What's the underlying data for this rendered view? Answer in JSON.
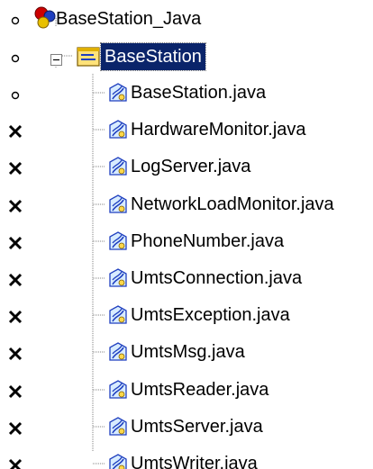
{
  "tree": {
    "root": {
      "label": "BaseStation_Java",
      "icon": "project-icon",
      "status": "circle"
    },
    "package": {
      "label": "BaseStation",
      "icon": "package-icon",
      "status": "circle",
      "selected": true,
      "expander": "minus"
    },
    "files": [
      {
        "label": "BaseStation.java",
        "status": "circle",
        "icon": "java-file-icon"
      },
      {
        "label": "HardwareMonitor.java",
        "status": "cross",
        "icon": "java-file-icon"
      },
      {
        "label": "LogServer.java",
        "status": "cross",
        "icon": "java-file-icon"
      },
      {
        "label": "NetworkLoadMonitor.java",
        "status": "cross",
        "icon": "java-file-icon"
      },
      {
        "label": "PhoneNumber.java",
        "status": "cross",
        "icon": "java-file-icon"
      },
      {
        "label": "UmtsConnection.java",
        "status": "cross",
        "icon": "java-file-icon"
      },
      {
        "label": "UmtsException.java",
        "status": "cross",
        "icon": "java-file-icon"
      },
      {
        "label": "UmtsMsg.java",
        "status": "cross",
        "icon": "java-file-icon"
      },
      {
        "label": "UmtsReader.java",
        "status": "cross",
        "icon": "java-file-icon"
      },
      {
        "label": "UmtsServer.java",
        "status": "cross",
        "icon": "java-file-icon"
      },
      {
        "label": "UmtsWriter.java",
        "status": "cross",
        "icon": "java-file-icon"
      }
    ]
  },
  "colors": {
    "selection": "#0a246a",
    "tree_line": "#808080",
    "status_mark": "#000000"
  }
}
